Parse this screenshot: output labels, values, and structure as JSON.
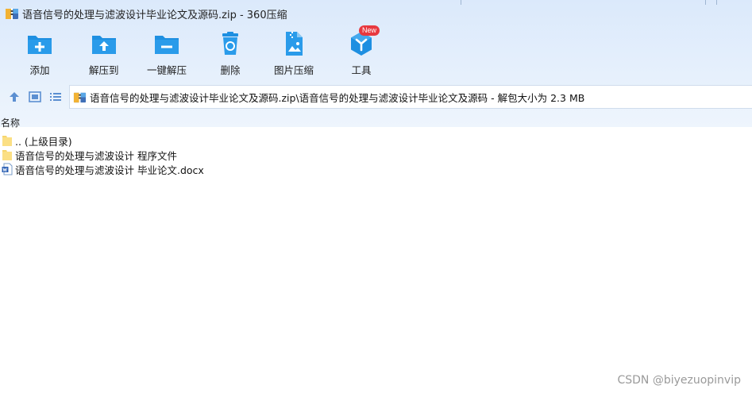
{
  "window": {
    "title": "语音信号的处理与滤波设计毕业论文及源码.zip - 360压缩"
  },
  "toolbar": {
    "items": [
      {
        "label": "添加",
        "icon": "add-folder-icon"
      },
      {
        "label": "解压到",
        "icon": "extract-to-icon"
      },
      {
        "label": "一键解压",
        "icon": "one-click-extract-icon"
      },
      {
        "label": "删除",
        "icon": "trash-icon"
      },
      {
        "label": "图片压缩",
        "icon": "image-compress-icon"
      },
      {
        "label": "工具",
        "icon": "tools-icon",
        "badge": "New"
      }
    ]
  },
  "address": {
    "path": "语音信号的处理与滤波设计毕业论文及源码.zip\\语音信号的处理与滤波设计毕业论文及源码 - 解包大小为 2.3 MB"
  },
  "list": {
    "column_name": "名称",
    "items": [
      {
        "name": ".. (上级目录)",
        "type": "folder"
      },
      {
        "name": "语音信号的处理与滤波设计 程序文件",
        "type": "folder"
      },
      {
        "name": "语音信号的处理与滤波设计 毕业论文.docx",
        "type": "docx"
      }
    ]
  },
  "watermark": "CSDN @biyezuopinvip",
  "colors": {
    "accent": "#1e8fe1",
    "header_bg": "#dbe9fb",
    "badge": "#e8393f",
    "folder": "#f7d56d"
  }
}
